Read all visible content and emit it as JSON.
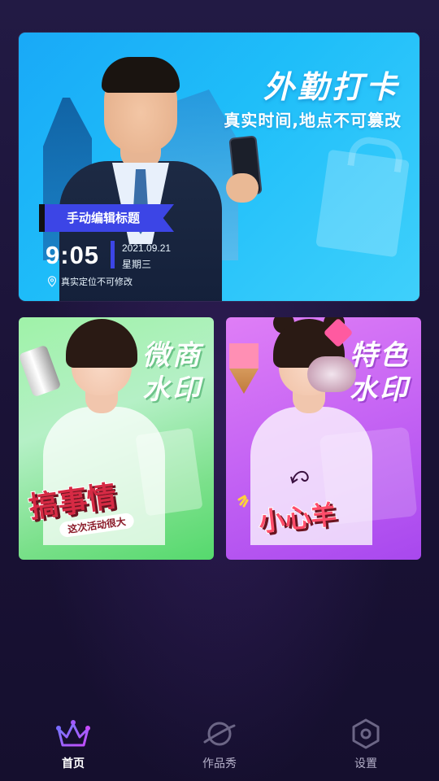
{
  "banner": {
    "title": "外勤打卡",
    "subtitle": "真实时间,地点不可篡改",
    "ribbon_label": "手动编辑标题",
    "time": "9:05",
    "date": "2021.09.21",
    "weekday": "星期三",
    "location_note": "真实定位不可修改",
    "icon": "location-pin-icon",
    "colors": {
      "bg_start": "#19a9f7",
      "bg_end": "#3fd0fb",
      "ribbon": "#3c45e6"
    }
  },
  "cards": [
    {
      "title_line1": "微商",
      "title_line2": "水印",
      "sticker_main": "搞事情",
      "sticker_sub": "这次活动很大",
      "color": "#7ae08a"
    },
    {
      "title_line1": "特色",
      "title_line2": "水印",
      "sticker_main": "小心羊",
      "color": "#c766f4"
    }
  ],
  "nav": {
    "items": [
      {
        "label": "首页",
        "icon": "crown-icon",
        "active": true
      },
      {
        "label": "作品秀",
        "icon": "planet-icon",
        "active": false
      },
      {
        "label": "设置",
        "icon": "hexagon-settings-icon",
        "active": false
      }
    ]
  }
}
